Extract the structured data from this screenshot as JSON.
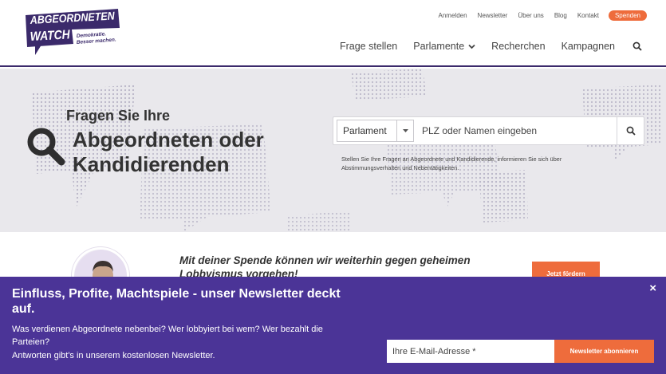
{
  "logo": {
    "line1": "ABGEORDNETEN",
    "line2": "WATCH",
    "tagline1": "Demokratie.",
    "tagline2": "Besser machen."
  },
  "topnav": {
    "login": "Anmelden",
    "newsletter": "Newsletter",
    "about": "Über uns",
    "blog": "Blog",
    "contact": "Kontakt",
    "donate": "Spenden"
  },
  "mainnav": {
    "ask": "Frage stellen",
    "parliaments": "Parlamente",
    "research": "Recherchen",
    "campaigns": "Kampagnen"
  },
  "hero": {
    "kicker": "Fragen Sie Ihre",
    "title": "Abgeordneten oder Kandidierenden",
    "select_value": "Parlament",
    "search_placeholder": "PLZ oder Namen eingeben",
    "description": "Stellen Sie Ihre Fragen an Abgeordnete und Kandidierende, informieren Sie sich über Abstimmungsverhalten und Nebentätigkeiten."
  },
  "donation": {
    "text": "Mit deiner Spende können wir weiterhin gegen geheimen Lobbyismus vorgehen!",
    "button": "Jetzt fördern"
  },
  "newsletter": {
    "title": "Einfluss, Profite, Machtspiele - unser Newsletter deckt auf.",
    "subtitle_line1": "Was verdienen Abgeordnete nebenbei? Wer lobbyiert bei wem? Wer bezahlt die Parteien?",
    "subtitle_line2": "Antworten gibt's in unserem kostenlosen Newsletter.",
    "email_placeholder": "Ihre E-Mail-Adresse *",
    "button": "Newsletter abonnieren",
    "close": "×"
  },
  "colors": {
    "brand_purple": "#4b3497",
    "accent_orange": "#ee6c3c",
    "hero_bg": "#e9e8ec"
  },
  "icons": {
    "search": "search-icon",
    "caret": "chevron-down-icon",
    "close": "close-icon"
  }
}
